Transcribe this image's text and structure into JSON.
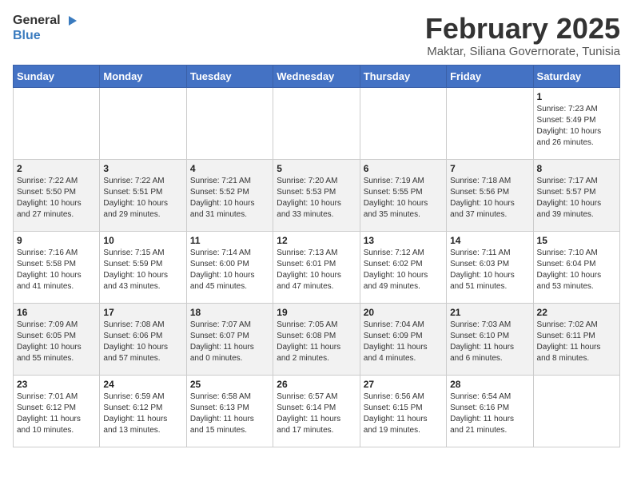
{
  "header": {
    "logo_general": "General",
    "logo_blue": "Blue",
    "month_title": "February 2025",
    "location": "Maktar, Siliana Governorate, Tunisia"
  },
  "days_of_week": [
    "Sunday",
    "Monday",
    "Tuesday",
    "Wednesday",
    "Thursday",
    "Friday",
    "Saturday"
  ],
  "weeks": [
    [
      {
        "day": "",
        "info": ""
      },
      {
        "day": "",
        "info": ""
      },
      {
        "day": "",
        "info": ""
      },
      {
        "day": "",
        "info": ""
      },
      {
        "day": "",
        "info": ""
      },
      {
        "day": "",
        "info": ""
      },
      {
        "day": "1",
        "info": "Sunrise: 7:23 AM\nSunset: 5:49 PM\nDaylight: 10 hours\nand 26 minutes."
      }
    ],
    [
      {
        "day": "2",
        "info": "Sunrise: 7:22 AM\nSunset: 5:50 PM\nDaylight: 10 hours\nand 27 minutes."
      },
      {
        "day": "3",
        "info": "Sunrise: 7:22 AM\nSunset: 5:51 PM\nDaylight: 10 hours\nand 29 minutes."
      },
      {
        "day": "4",
        "info": "Sunrise: 7:21 AM\nSunset: 5:52 PM\nDaylight: 10 hours\nand 31 minutes."
      },
      {
        "day": "5",
        "info": "Sunrise: 7:20 AM\nSunset: 5:53 PM\nDaylight: 10 hours\nand 33 minutes."
      },
      {
        "day": "6",
        "info": "Sunrise: 7:19 AM\nSunset: 5:55 PM\nDaylight: 10 hours\nand 35 minutes."
      },
      {
        "day": "7",
        "info": "Sunrise: 7:18 AM\nSunset: 5:56 PM\nDaylight: 10 hours\nand 37 minutes."
      },
      {
        "day": "8",
        "info": "Sunrise: 7:17 AM\nSunset: 5:57 PM\nDaylight: 10 hours\nand 39 minutes."
      }
    ],
    [
      {
        "day": "9",
        "info": "Sunrise: 7:16 AM\nSunset: 5:58 PM\nDaylight: 10 hours\nand 41 minutes."
      },
      {
        "day": "10",
        "info": "Sunrise: 7:15 AM\nSunset: 5:59 PM\nDaylight: 10 hours\nand 43 minutes."
      },
      {
        "day": "11",
        "info": "Sunrise: 7:14 AM\nSunset: 6:00 PM\nDaylight: 10 hours\nand 45 minutes."
      },
      {
        "day": "12",
        "info": "Sunrise: 7:13 AM\nSunset: 6:01 PM\nDaylight: 10 hours\nand 47 minutes."
      },
      {
        "day": "13",
        "info": "Sunrise: 7:12 AM\nSunset: 6:02 PM\nDaylight: 10 hours\nand 49 minutes."
      },
      {
        "day": "14",
        "info": "Sunrise: 7:11 AM\nSunset: 6:03 PM\nDaylight: 10 hours\nand 51 minutes."
      },
      {
        "day": "15",
        "info": "Sunrise: 7:10 AM\nSunset: 6:04 PM\nDaylight: 10 hours\nand 53 minutes."
      }
    ],
    [
      {
        "day": "16",
        "info": "Sunrise: 7:09 AM\nSunset: 6:05 PM\nDaylight: 10 hours\nand 55 minutes."
      },
      {
        "day": "17",
        "info": "Sunrise: 7:08 AM\nSunset: 6:06 PM\nDaylight: 10 hours\nand 57 minutes."
      },
      {
        "day": "18",
        "info": "Sunrise: 7:07 AM\nSunset: 6:07 PM\nDaylight: 11 hours\nand 0 minutes."
      },
      {
        "day": "19",
        "info": "Sunrise: 7:05 AM\nSunset: 6:08 PM\nDaylight: 11 hours\nand 2 minutes."
      },
      {
        "day": "20",
        "info": "Sunrise: 7:04 AM\nSunset: 6:09 PM\nDaylight: 11 hours\nand 4 minutes."
      },
      {
        "day": "21",
        "info": "Sunrise: 7:03 AM\nSunset: 6:10 PM\nDaylight: 11 hours\nand 6 minutes."
      },
      {
        "day": "22",
        "info": "Sunrise: 7:02 AM\nSunset: 6:11 PM\nDaylight: 11 hours\nand 8 minutes."
      }
    ],
    [
      {
        "day": "23",
        "info": "Sunrise: 7:01 AM\nSunset: 6:12 PM\nDaylight: 11 hours\nand 10 minutes."
      },
      {
        "day": "24",
        "info": "Sunrise: 6:59 AM\nSunset: 6:12 PM\nDaylight: 11 hours\nand 13 minutes."
      },
      {
        "day": "25",
        "info": "Sunrise: 6:58 AM\nSunset: 6:13 PM\nDaylight: 11 hours\nand 15 minutes."
      },
      {
        "day": "26",
        "info": "Sunrise: 6:57 AM\nSunset: 6:14 PM\nDaylight: 11 hours\nand 17 minutes."
      },
      {
        "day": "27",
        "info": "Sunrise: 6:56 AM\nSunset: 6:15 PM\nDaylight: 11 hours\nand 19 minutes."
      },
      {
        "day": "28",
        "info": "Sunrise: 6:54 AM\nSunset: 6:16 PM\nDaylight: 11 hours\nand 21 minutes."
      },
      {
        "day": "",
        "info": ""
      }
    ]
  ]
}
